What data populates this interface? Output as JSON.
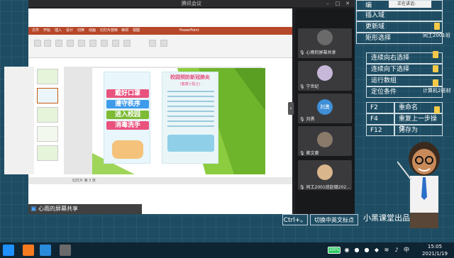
{
  "window": {
    "title": "腾讯会议",
    "now_speaking": "正在讲话:"
  },
  "ppt": {
    "app_title": "PowerPoint",
    "tabs": [
      "文件",
      "开始",
      "插入",
      "设计",
      "切换",
      "动画",
      "幻灯片放映",
      "审阅",
      "视图"
    ],
    "status": "幻灯片 第 3 张"
  },
  "slide": {
    "left_lines": [
      "戴好口罩",
      "遵守秩序",
      "进入校园",
      "消毒洗手"
    ],
    "left_colors": [
      "#e8527d",
      "#3d9be9",
      "#7dbb35",
      "#e8527d"
    ],
    "right_title": "校园预防新冠肺炎",
    "right_subtitle": "(健康小贴士)"
  },
  "share_label": "心雨的屏幕共享",
  "participants": [
    {
      "name": "心雨的屏幕共享",
      "avatar": "#6a6a6a"
    },
    {
      "name": "宁世纪",
      "avatar": "#c7b7d8"
    },
    {
      "name": "刘勇",
      "avatar": "#3f8fd6",
      "avatar_text": "刘勇"
    },
    {
      "name": "崔文豪",
      "avatar": "#8a7a6a"
    },
    {
      "name": "同工2001班赵璐202...",
      "avatar": "#d9b68b"
    }
  ],
  "notes": {
    "top": [
      "编",
      "插入域",
      "更新域",
      "矩形选择"
    ],
    "mid": [
      "连续向右选择",
      "连续向下选择",
      "运行数组",
      "定位条件"
    ],
    "files": [
      "同工2001班",
      "计算机2班材"
    ],
    "shortcuts": [
      {
        "key": "F2",
        "desc": "重命名"
      },
      {
        "key": "F4",
        "desc": "重复上一步操作"
      },
      {
        "key": "F12",
        "desc": "另存为"
      }
    ]
  },
  "hints": {
    "ctrl": "Ctrl+。",
    "switch": "切换中英文标点"
  },
  "brand": "小黑课堂出品",
  "taskbar": {
    "time": "15:05",
    "date": "2021/1/19",
    "battery": "100%"
  }
}
